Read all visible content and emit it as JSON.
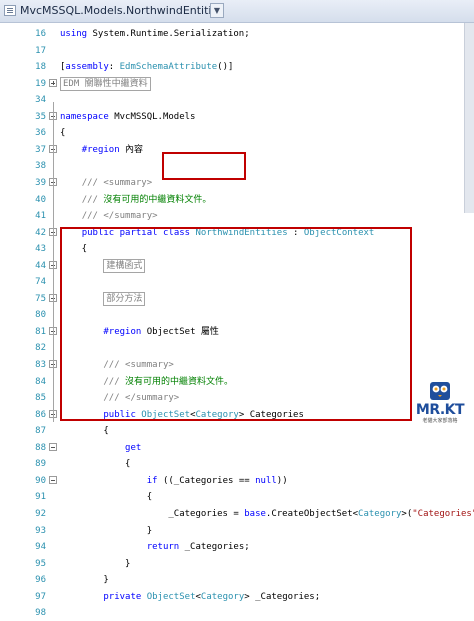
{
  "title_tab": {
    "label": "MvcMSSQL.Models.NorthwindEntities"
  },
  "lines": [
    {
      "num": "16",
      "t": [
        {
          "k": "kw",
          "v": "using"
        },
        {
          "k": "",
          "v": " System.Runtime.Serialization;"
        }
      ]
    },
    {
      "num": "17",
      "t": []
    },
    {
      "num": "18",
      "t": [
        {
          "k": "",
          "v": "["
        },
        {
          "k": "kw",
          "v": "assembly"
        },
        {
          "k": "",
          "v": ": "
        },
        {
          "k": "ty",
          "v": "EdmSchemaAttribute"
        },
        {
          "k": "",
          "v": "()]"
        }
      ]
    },
    {
      "num": "19",
      "fold": "plus",
      "t": [
        {
          "k": "box",
          "v": "EDM 關聯性中繼資料"
        }
      ]
    },
    {
      "num": "34",
      "t": []
    },
    {
      "num": "35",
      "fold": "minus",
      "t": [
        {
          "k": "kw",
          "v": "namespace"
        },
        {
          "k": "",
          "v": " MvcMSSQL.Models"
        }
      ]
    },
    {
      "num": "36",
      "t": [
        {
          "k": "",
          "v": "{"
        }
      ]
    },
    {
      "num": "37",
      "fold": "minus",
      "t": [
        {
          "k": "",
          "v": "    "
        },
        {
          "k": "kw",
          "v": "#region"
        },
        {
          "k": "",
          "v": " 內容"
        }
      ]
    },
    {
      "num": "38",
      "t": []
    },
    {
      "num": "39",
      "fold": "minus",
      "t": [
        {
          "k": "",
          "v": "    "
        },
        {
          "k": "cg",
          "v": "/// <summary>"
        }
      ]
    },
    {
      "num": "40",
      "t": [
        {
          "k": "",
          "v": "    "
        },
        {
          "k": "cg",
          "v": "///"
        },
        {
          "k": "cm",
          "v": " 沒有可用的中繼資料文件。"
        }
      ]
    },
    {
      "num": "41",
      "t": [
        {
          "k": "",
          "v": "    "
        },
        {
          "k": "cg",
          "v": "/// </summary>"
        }
      ]
    },
    {
      "num": "42",
      "fold": "minus",
      "t": [
        {
          "k": "",
          "v": "    "
        },
        {
          "k": "kw",
          "v": "public"
        },
        {
          "k": "",
          "v": " "
        },
        {
          "k": "kw",
          "v": "partial"
        },
        {
          "k": "",
          "v": " "
        },
        {
          "k": "kw",
          "v": "class"
        },
        {
          "k": "",
          "v": " "
        },
        {
          "k": "ty",
          "v": "NorthwindEntities"
        },
        {
          "k": "",
          "v": " : "
        },
        {
          "k": "ty",
          "v": "ObjectContext"
        }
      ]
    },
    {
      "num": "43",
      "t": [
        {
          "k": "",
          "v": "    {"
        }
      ]
    },
    {
      "num": "44",
      "fold": "plus",
      "t": [
        {
          "k": "",
          "v": "        "
        },
        {
          "k": "box",
          "v": "建構函式"
        }
      ]
    },
    {
      "num": "74",
      "t": []
    },
    {
      "num": "75",
      "fold": "plus",
      "t": [
        {
          "k": "",
          "v": "        "
        },
        {
          "k": "box",
          "v": "部分方法"
        }
      ]
    },
    {
      "num": "80",
      "t": []
    },
    {
      "num": "81",
      "fold": "minus",
      "t": [
        {
          "k": "",
          "v": "        "
        },
        {
          "k": "kw",
          "v": "#region"
        },
        {
          "k": "",
          "v": " ObjectSet 屬性"
        }
      ]
    },
    {
      "num": "82",
      "t": []
    },
    {
      "num": "83",
      "fold": "minus",
      "t": [
        {
          "k": "",
          "v": "        "
        },
        {
          "k": "cg",
          "v": "/// <summary>"
        }
      ]
    },
    {
      "num": "84",
      "t": [
        {
          "k": "",
          "v": "        "
        },
        {
          "k": "cg",
          "v": "///"
        },
        {
          "k": "cm",
          "v": " 沒有可用的中繼資料文件。"
        }
      ]
    },
    {
      "num": "85",
      "t": [
        {
          "k": "",
          "v": "        "
        },
        {
          "k": "cg",
          "v": "/// </summary>"
        }
      ]
    },
    {
      "num": "86",
      "fold": "minus",
      "t": [
        {
          "k": "",
          "v": "        "
        },
        {
          "k": "kw",
          "v": "public"
        },
        {
          "k": "",
          "v": " "
        },
        {
          "k": "ty",
          "v": "ObjectSet"
        },
        {
          "k": "",
          "v": "<"
        },
        {
          "k": "ty",
          "v": "Category"
        },
        {
          "k": "",
          "v": "> Categories"
        }
      ]
    },
    {
      "num": "87",
      "t": [
        {
          "k": "",
          "v": "        {"
        }
      ]
    },
    {
      "num": "88",
      "fold": "minus",
      "t": [
        {
          "k": "",
          "v": "            "
        },
        {
          "k": "kw",
          "v": "get"
        }
      ]
    },
    {
      "num": "89",
      "t": [
        {
          "k": "",
          "v": "            {"
        }
      ]
    },
    {
      "num": "90",
      "fold": "minus",
      "t": [
        {
          "k": "",
          "v": "                "
        },
        {
          "k": "kw",
          "v": "if"
        },
        {
          "k": "",
          "v": " ((_Categories == "
        },
        {
          "k": "kw",
          "v": "null"
        },
        {
          "k": "",
          "v": "))"
        }
      ]
    },
    {
      "num": "91",
      "t": [
        {
          "k": "",
          "v": "                {"
        }
      ]
    },
    {
      "num": "92",
      "t": [
        {
          "k": "",
          "v": "                    _Categories = "
        },
        {
          "k": "kw",
          "v": "base"
        },
        {
          "k": "",
          "v": ".CreateObjectSet<"
        },
        {
          "k": "ty",
          "v": "Category"
        },
        {
          "k": "",
          "v": ">("
        },
        {
          "k": "str",
          "v": "\"Categories\""
        },
        {
          "k": "",
          "v": ");"
        }
      ]
    },
    {
      "num": "93",
      "t": [
        {
          "k": "",
          "v": "                }"
        }
      ]
    },
    {
      "num": "94",
      "t": [
        {
          "k": "",
          "v": "                "
        },
        {
          "k": "kw",
          "v": "return"
        },
        {
          "k": "",
          "v": " _Categories;"
        }
      ]
    },
    {
      "num": "95",
      "t": [
        {
          "k": "",
          "v": "            }"
        }
      ]
    },
    {
      "num": "96",
      "t": [
        {
          "k": "",
          "v": "        }"
        }
      ]
    },
    {
      "num": "97",
      "t": [
        {
          "k": "",
          "v": "        "
        },
        {
          "k": "kw",
          "v": "private"
        },
        {
          "k": "",
          "v": " "
        },
        {
          "k": "ty",
          "v": "ObjectSet"
        },
        {
          "k": "",
          "v": "<"
        },
        {
          "k": "ty",
          "v": "Category"
        },
        {
          "k": "",
          "v": "> _Categories;"
        }
      ]
    },
    {
      "num": "98",
      "t": []
    }
  ],
  "logo": {
    "name": "MR.KT",
    "subtitle": "老貓大家部落格"
  },
  "colors": {
    "keyword": "#0000ff",
    "type": "#2b91af",
    "comment": "#008000",
    "doc": "#808080",
    "string": "#a31515",
    "highlight": "#c00000"
  }
}
